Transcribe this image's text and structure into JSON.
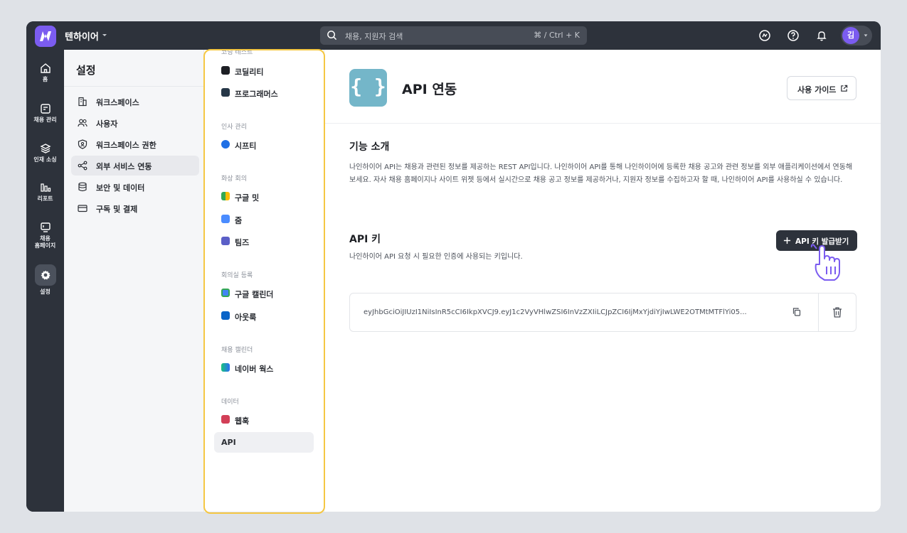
{
  "topbar": {
    "workspace": "텐하이어",
    "search_placeholder": "채용, 지원자 검색",
    "search_shortcut": "⌘ / Ctrl + K",
    "avatar_initial": "김"
  },
  "rail": {
    "items": [
      {
        "icon": "home-icon",
        "label": "홈"
      },
      {
        "icon": "recruit-icon",
        "label": "채용 관리"
      },
      {
        "icon": "layers-icon",
        "label": "인재 소싱"
      },
      {
        "icon": "report-icon",
        "label": "리포트"
      },
      {
        "icon": "monitor-icon",
        "label": "채용",
        "label2": "홈페이지"
      },
      {
        "icon": "gear-icon",
        "label": "설정"
      }
    ]
  },
  "settings": {
    "title": "설정",
    "items": [
      {
        "icon": "building-icon",
        "label": "워크스페이스"
      },
      {
        "icon": "users-icon",
        "label": "사용자"
      },
      {
        "icon": "shield-user-icon",
        "label": "워크스페이스 권한"
      },
      {
        "icon": "share-icon",
        "label": "외부 서비스 연동"
      },
      {
        "icon": "database-icon",
        "label": "보안 및 데이터"
      },
      {
        "icon": "card-icon",
        "label": "구독 및 결제"
      }
    ]
  },
  "integrations": {
    "top_partial": "코딩 테스트",
    "items_coding": [
      "코딜리티",
      "프로그래머스"
    ],
    "groups": [
      "인사 관리",
      "화상 회의",
      "회의실 등록",
      "채용 캘린더",
      "데이터"
    ],
    "items_hr": [
      "시프티"
    ],
    "items_video": [
      "구글 밋",
      "줌",
      "팀즈"
    ],
    "items_room": [
      "구글 캘린더",
      "아웃룩"
    ],
    "items_calendar": [
      "네이버 웍스"
    ],
    "items_data": [
      "웹훅",
      "API"
    ]
  },
  "main": {
    "logo_glyph": "{ }",
    "title": "API 연동",
    "guide_button": "사용 가이드",
    "intro_title": "기능 소개",
    "intro_text": "나인하이어 API는 채용과 관련된 정보를 제공하는 REST API입니다. 나인하이어 API를 통해 나인하이어에 등록한 채용 공고와 관련 정보를 외부 애플리케이션에서 연동해 보세요. 자사 채용 홈페이지나 사이트 위젯 등에서 실시간으로 채용 공고 정보를 제공하거나, 지원자 정보를 수집하고자 할 때, 나인하이어 API를 사용하실 수 있습니다.",
    "api_key_title": "API 키",
    "api_key_sub": "나인하이어 API 요청 시 필요한 인증에 사용되는 키입니다.",
    "issue_button": "API 키 발급받기",
    "api_key_value": "eyJhbGciOiJIUzI1NiIsInR5cCI6IkpXVCJ9.eyJ1c2VyVHlwZSI6InVzZXIiLCJpZCI6IjMxYjdiYjIwLWE2OTMtMTFlYi05..."
  },
  "colors": {
    "accent": "#7b5cf0",
    "dark": "#2d323b",
    "api_logo": "#74b6c9",
    "highlight": "#f5c743"
  }
}
